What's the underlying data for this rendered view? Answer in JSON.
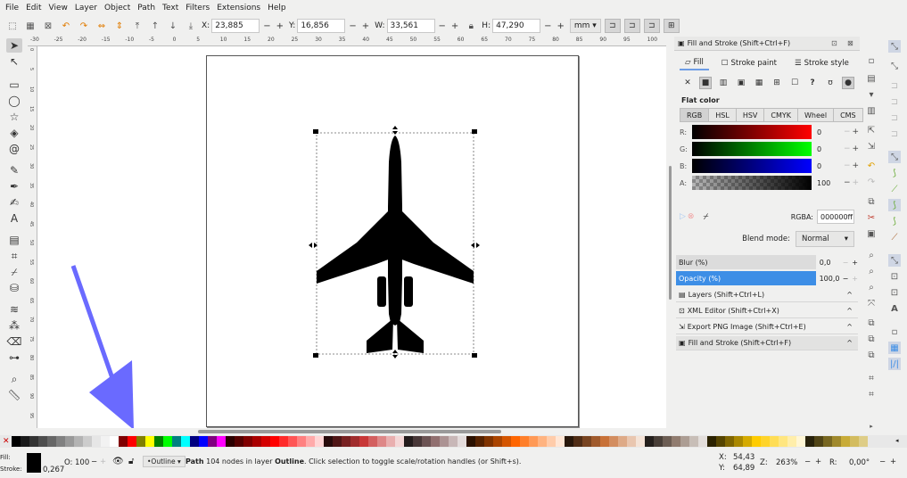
{
  "menu": [
    "File",
    "Edit",
    "View",
    "Layer",
    "Object",
    "Path",
    "Text",
    "Filters",
    "Extensions",
    "Help"
  ],
  "toolbar": {
    "x_label": "X:",
    "x_value": "23,885",
    "y_label": "Y:",
    "y_value": "16,856",
    "w_label": "W:",
    "w_value": "33,561",
    "h_label": "H:",
    "h_value": "47,290",
    "unit": "mm",
    "minus": "−",
    "plus": "+"
  },
  "ruler": {
    "h_ticks": [
      "-30",
      "-25",
      "-20",
      "-15",
      "-10",
      "-5",
      "0",
      "5",
      "10",
      "15",
      "20",
      "25",
      "30",
      "35",
      "40",
      "45",
      "50",
      "55",
      "60",
      "65",
      "70",
      "75",
      "80",
      "85",
      "90",
      "95",
      "100"
    ],
    "v_ticks": [
      "0",
      "5",
      "10",
      "15",
      "20",
      "25",
      "30",
      "35",
      "40",
      "45",
      "50",
      "55",
      "60",
      "65",
      "70",
      "75",
      "80",
      "85",
      "90",
      "95"
    ]
  },
  "dock": {
    "title": "Fill and Stroke (Shift+Ctrl+F)",
    "tab_fill": "Fill",
    "tab_stroke_paint": "Stroke paint",
    "tab_stroke_style": "Stroke style",
    "flat_color": "Flat color",
    "modes": [
      "RGB",
      "HSL",
      "HSV",
      "CMYK",
      "Wheel",
      "CMS"
    ],
    "channels": [
      {
        "label": "R:",
        "value": "0"
      },
      {
        "label": "G:",
        "value": "0"
      },
      {
        "label": "B:",
        "value": "0"
      },
      {
        "label": "A:",
        "value": "100"
      }
    ],
    "rgba_label": "RGBA:",
    "rgba_value": "000000ff",
    "blend_label": "Blend mode:",
    "blend_value": "Normal",
    "blur_label": "Blur (%)",
    "blur_value": "0,0",
    "opacity_label": "Opacity (%)",
    "opacity_value": "100,0",
    "panels": [
      "Layers (Shift+Ctrl+L)",
      "XML Editor (Shift+Ctrl+X)",
      "Export PNG Image (Shift+Ctrl+E)",
      "Fill and Stroke (Shift+Ctrl+F)"
    ]
  },
  "status": {
    "fill_label": "Fill:",
    "stroke_label": "Stroke:",
    "stroke_width": "0,267",
    "opacity_label": "O:",
    "opacity_value": "100",
    "layer_name": "•Outline",
    "message_bold": "Path",
    "message": " 104 nodes in layer ",
    "message_layer": "Outline",
    "message_tail": ". Click selection to toggle scale/rotation handles (or Shift+s).",
    "cursor_x_label": "X:",
    "cursor_x": "54,43",
    "cursor_y_label": "Y:",
    "cursor_y": "64,89",
    "zoom_label": "Z:",
    "zoom_value": "263%",
    "rot_label": "R:",
    "rot_value": "0,00°"
  },
  "colors": {
    "accent": "#4a90d9",
    "arrow": "#6a6aff",
    "selected_row": "#3d8ee6",
    "fill": "#000000"
  },
  "palette": [
    "#000000",
    "#1a1a1a",
    "#333333",
    "#4d4d4d",
    "#666666",
    "#808080",
    "#999999",
    "#b3b3b3",
    "#cccccc",
    "#e6e6e6",
    "#f2f2f2",
    "#ffffff",
    "#800000",
    "#ff0000",
    "#808000",
    "#ffff00",
    "#008000",
    "#00ff00",
    "#008080",
    "#00ffff",
    "#000080",
    "#0000ff",
    "#800080",
    "#ff00ff",
    "#2b0000",
    "#550000",
    "#800000",
    "#aa0000",
    "#d40000",
    "#ff0000",
    "#ff2a2a",
    "#ff5555",
    "#ff8080",
    "#ffaaaa",
    "#ffd5d5",
    "#280b0b",
    "#501616",
    "#782121",
    "#a02c2c",
    "#c83737",
    "#d35f5f",
    "#de8787",
    "#e9afaf",
    "#f4d7d7",
    "#241c1c",
    "#483737",
    "#6c5353",
    "#916f6f",
    "#ac9393",
    "#c8b7b7",
    "#e3dbdb",
    "#2b1100",
    "#552200",
    "#803300",
    "#aa4400",
    "#d45500",
    "#ff6600",
    "#ff7f2a",
    "#ff9955",
    "#ffb380",
    "#ffccaa",
    "#ffe6d5",
    "#28170b",
    "#502d16",
    "#784421",
    "#a05a2c",
    "#c87137",
    "#d38d5f",
    "#deaa87",
    "#e9c6af",
    "#f4e3d7",
    "#241f1c",
    "#483e37",
    "#6c5d53",
    "#917c6f",
    "#ac9d93",
    "#c8beb7",
    "#e3dedb",
    "#2b2200",
    "#554400",
    "#806600",
    "#aa8800",
    "#d4aa00",
    "#ffcc00",
    "#ffd42a",
    "#ffdd55",
    "#ffe680",
    "#ffeeaa",
    "#fff6d5",
    "#28220b",
    "#504416",
    "#786721",
    "#a0892c",
    "#c8ab37",
    "#d3bc5f",
    "#decd87"
  ]
}
